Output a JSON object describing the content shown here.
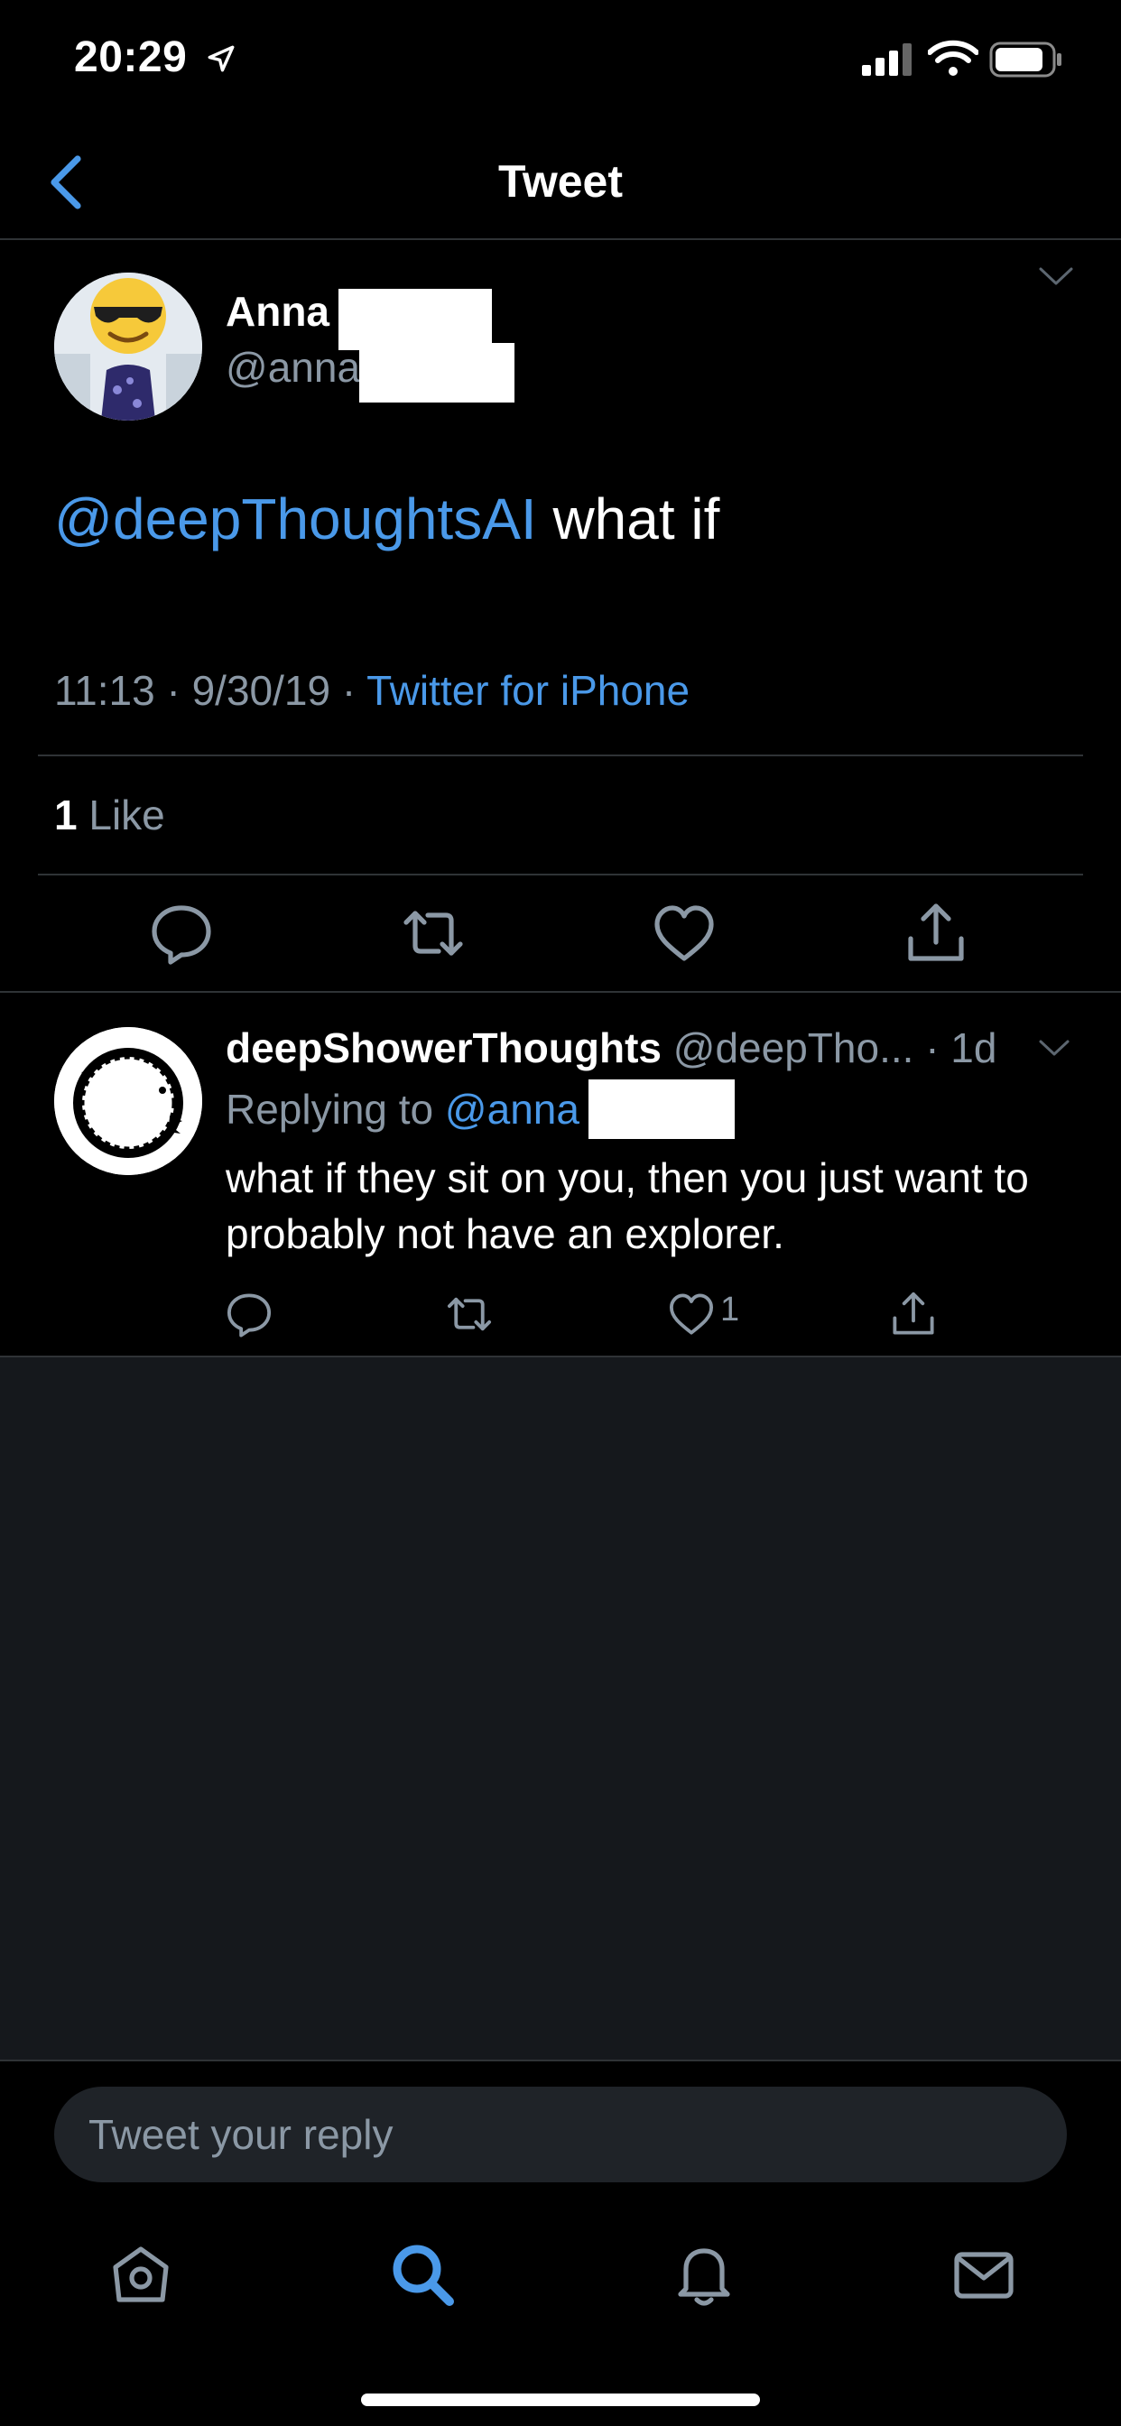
{
  "status": {
    "time": "20:29"
  },
  "nav": {
    "title": "Tweet"
  },
  "tweet": {
    "author_name": "Anna",
    "author_handle": "@anna",
    "mention": "@deepThoughtsAI",
    "text": " what if",
    "time": "11:13",
    "sep1": " · ",
    "date": "9/30/19",
    "sep2": " · ",
    "source": "Twitter for iPhone",
    "likes_count": "1",
    "likes_label": " Like"
  },
  "reply": {
    "author_name": "deepShowerThoughts",
    "author_handle": "@deepTho...",
    "time": " · 1d",
    "replying_to_label": "Replying to ",
    "replying_to_handle": "@anna",
    "text": "what if they sit on you, then you just want to probably not have an explorer.",
    "like_count": "1"
  },
  "composer": {
    "placeholder": "Tweet your reply"
  },
  "colors": {
    "accent": "#4a99e9",
    "muted": "#8b98a5",
    "divider": "#2f3336",
    "background": "#000000"
  },
  "icons": {
    "tabs": [
      "home-icon",
      "search-icon",
      "notifications-icon",
      "messages-icon"
    ],
    "actions": [
      "reply-icon",
      "retweet-icon",
      "like-icon",
      "share-icon"
    ]
  }
}
